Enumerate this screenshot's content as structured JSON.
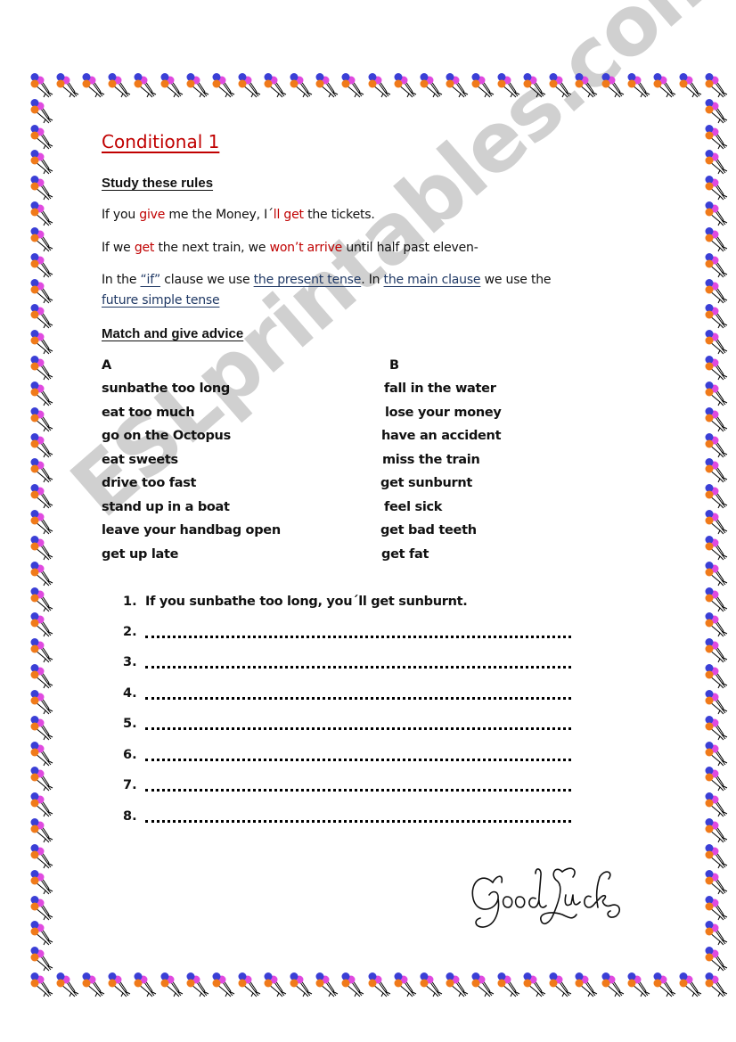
{
  "document": {
    "title": "Conditional 1",
    "study_heading": "Study these rules",
    "examples": [
      {
        "parts": [
          {
            "text": "If you ",
            "style": "plain"
          },
          {
            "text": "give",
            "style": "red"
          },
          {
            "text": " me the Money, I´",
            "style": "plain"
          },
          {
            "text": "ll get",
            "style": "red"
          },
          {
            "text": " the tickets.",
            "style": "plain"
          }
        ]
      },
      {
        "parts": [
          {
            "text": "If we ",
            "style": "plain"
          },
          {
            "text": "get",
            "style": "red"
          },
          {
            "text": " the next train, we ",
            "style": "plain"
          },
          {
            "text": "won’t arrive",
            "style": "red"
          },
          {
            "text": " until half past eleven-",
            "style": "plain"
          }
        ]
      }
    ],
    "rule": {
      "line1": [
        {
          "text": "In the ",
          "style": "plain"
        },
        {
          "text": "“if”",
          "style": "link"
        },
        {
          "text": " clause we use ",
          "style": "plain"
        },
        {
          "text": "the present tense",
          "style": "link"
        },
        {
          "text": ". In ",
          "style": "plain"
        },
        {
          "text": "the main clause",
          "style": "link"
        },
        {
          "text": " we use the",
          "style": "plain"
        }
      ],
      "line2": [
        {
          "text": "future simple tense",
          "style": "link"
        }
      ]
    },
    "match_heading": "Match and give advice",
    "column_a_header": "A",
    "column_b_header": "B",
    "column_a": [
      "sunbathe too long",
      "eat too much",
      "go on the Octopus",
      "eat sweets",
      "drive too fast",
      "stand up in a boat",
      "leave your handbag open",
      "get up late"
    ],
    "column_b": [
      "fall in the water",
      "lose your money",
      "have an accident",
      "miss the train",
      "get sunburnt",
      "feel sick",
      "get bad teeth",
      "get fat"
    ],
    "exercises": [
      {
        "number": "1.",
        "text": "If you sunbathe too long, you´ll get sunburnt.",
        "blank": false
      },
      {
        "number": "2.",
        "text": "",
        "blank": true
      },
      {
        "number": "3.",
        "text": "",
        "blank": true
      },
      {
        "number": "4.",
        "text": "",
        "blank": true
      },
      {
        "number": "5.",
        "text": "",
        "blank": true
      },
      {
        "number": "6.",
        "text": "",
        "blank": true
      },
      {
        "number": "7.",
        "text": "",
        "blank": true
      },
      {
        "number": "8.",
        "text": "",
        "blank": true
      }
    ],
    "closing_image_text": "Good Luck",
    "watermark": "ESLprintables.com"
  },
  "border": {
    "icon": "balloon-cluster-icon",
    "colors": {
      "blue": "#3a3fd6",
      "pink": "#e04ae0",
      "orange": "#f07a1a",
      "string": "#000000"
    }
  },
  "colors": {
    "accent_red": "#c00000",
    "link_navy": "#1f3864",
    "watermark_gray": "#c8c8c8"
  }
}
